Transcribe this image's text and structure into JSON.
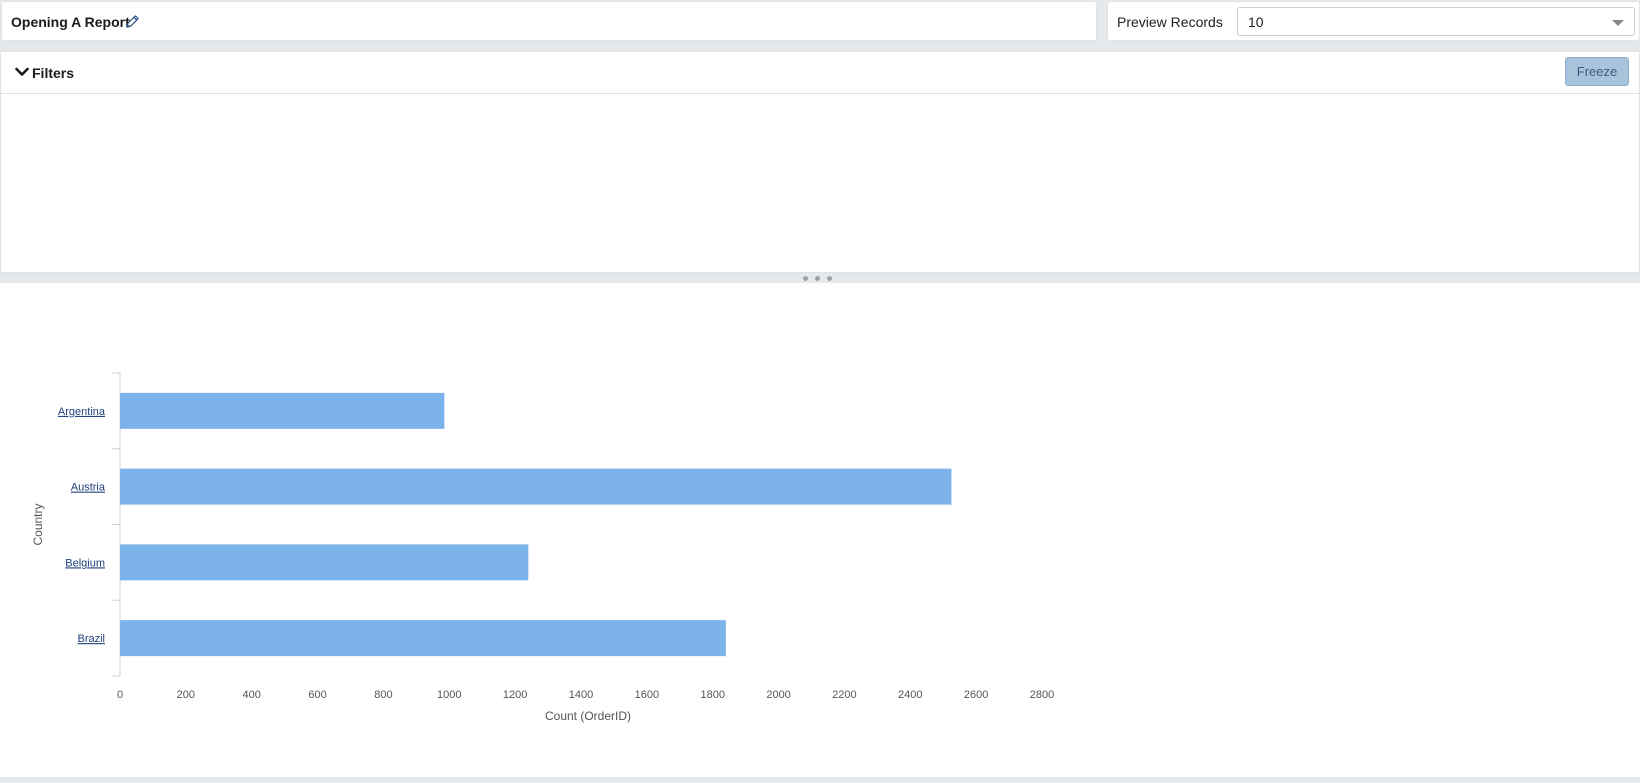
{
  "report": {
    "title": "Opening A Report",
    "edit_icon": "pencil-icon"
  },
  "preview": {
    "label": "Preview Records",
    "selected": "10",
    "caret_icon": "chevron-down-icon"
  },
  "filters": {
    "label": "Filters",
    "toggle_icon": "chevron-down-icon",
    "freeze_label": "Freeze"
  },
  "colors": {
    "bar": "#7db3eb",
    "axis": "#c7d0db",
    "tick_text": "#555555",
    "category_link": "#1f3f7a",
    "freeze_bg": "#a8c4dc"
  },
  "chart_data": {
    "type": "bar",
    "orientation": "horizontal",
    "categories": [
      "Argentina",
      "Austria",
      "Belgium",
      "Brazil"
    ],
    "values": [
      985,
      2525,
      1240,
      1840
    ],
    "xlabel": "Count (OrderID)",
    "ylabel": "Country",
    "xlim": [
      0,
      2800
    ],
    "xticks": [
      0,
      200,
      400,
      600,
      800,
      1000,
      1200,
      1400,
      1600,
      1800,
      2000,
      2200,
      2400,
      2600,
      2800
    ],
    "grid": false,
    "legend": "none"
  }
}
